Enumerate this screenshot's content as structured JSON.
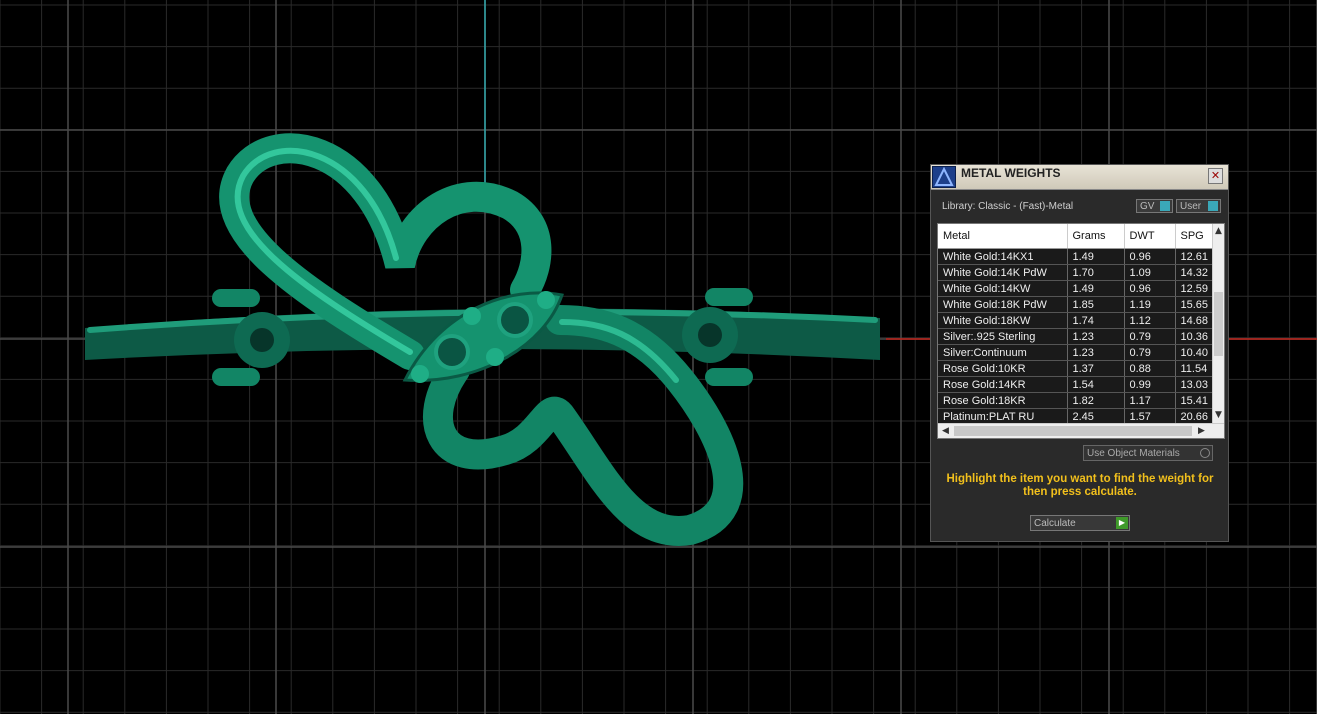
{
  "viewport": {
    "background": "#000000",
    "grid_color": "#4a4a4a",
    "axis_vertical_color": "#2fa7ab",
    "axis_horizontal_color": "#c0241b",
    "model_color": "#1a8a6a",
    "model_description": "green ring with heart-shaped ribbon and marquise centerpiece"
  },
  "panel": {
    "title": "METAL WEIGHTS",
    "close_label": "✕",
    "logo_icon": "app-logo-icon",
    "library_label": "Library: Classic - (Fast)-Metal",
    "toggle_gv": "GV",
    "toggle_user": "User",
    "columns": [
      "Metal",
      "Grams",
      "DWT",
      "SPG"
    ],
    "rows": [
      [
        "White Gold:14KX1",
        "1.49",
        "0.96",
        "12.61"
      ],
      [
        "White Gold:14K PdW",
        "1.70",
        "1.09",
        "14.32"
      ],
      [
        "White Gold:14KW",
        "1.49",
        "0.96",
        "12.59"
      ],
      [
        "White Gold:18K PdW",
        "1.85",
        "1.19",
        "15.65"
      ],
      [
        "White Gold:18KW",
        "1.74",
        "1.12",
        "14.68"
      ],
      [
        "Silver:.925 Sterling",
        "1.23",
        "0.79",
        "10.36"
      ],
      [
        "Silver:Continuum",
        "1.23",
        "0.79",
        "10.40"
      ],
      [
        "Rose Gold:10KR",
        "1.37",
        "0.88",
        "11.54"
      ],
      [
        "Rose Gold:14KR",
        "1.54",
        "0.99",
        "13.03"
      ],
      [
        "Rose Gold:18KR",
        "1.82",
        "1.17",
        "15.41"
      ],
      [
        "Platinum:PLAT RU",
        "2.45",
        "1.57",
        "20.66"
      ]
    ],
    "use_object_materials": "Use Object Materials",
    "hint": "Highlight the item you want to find the weight for then press calculate.",
    "calculate_label": "Calculate",
    "accent": "#f2c01c"
  }
}
